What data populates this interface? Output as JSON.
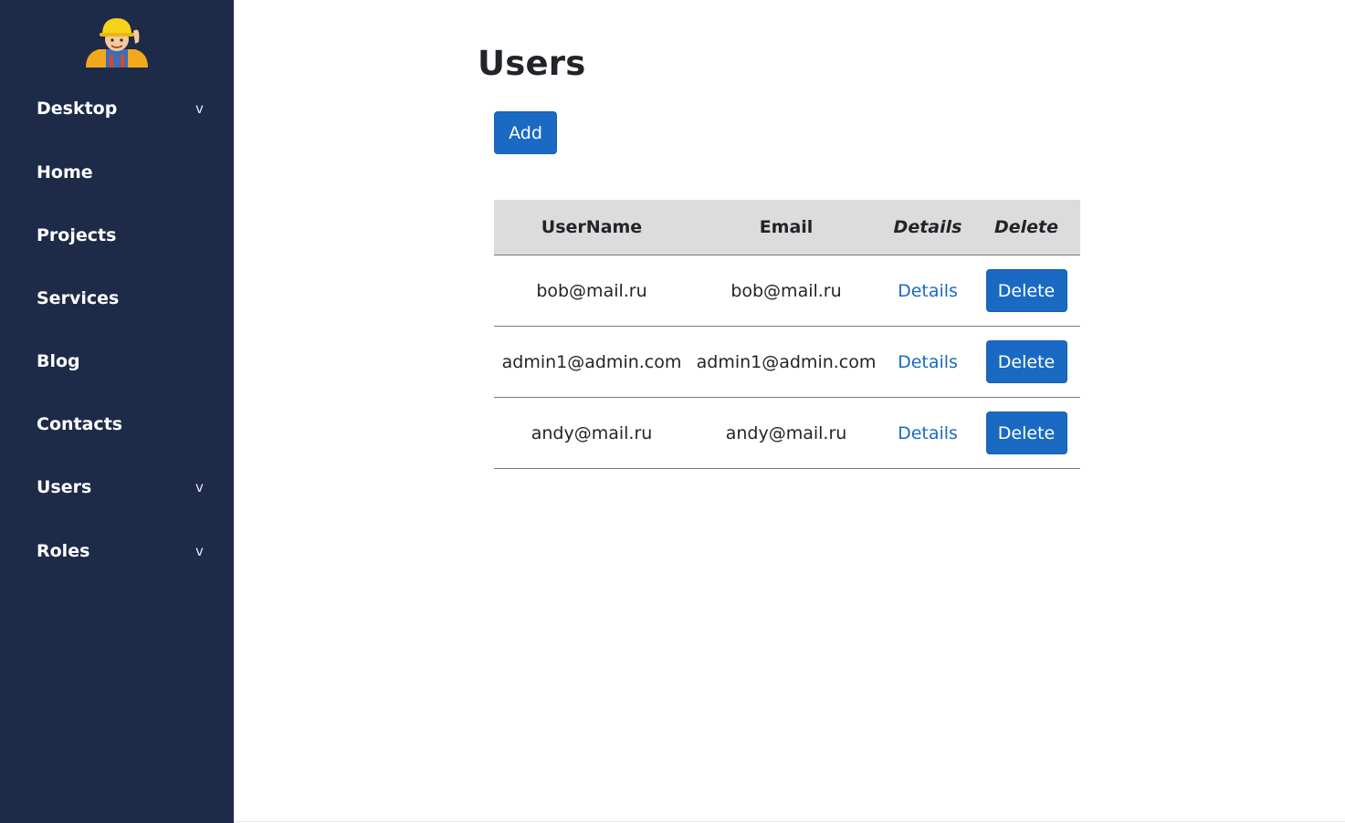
{
  "sidebar": {
    "items": [
      {
        "label": "Desktop",
        "chevron": "v"
      },
      {
        "label": "Home"
      },
      {
        "label": "Projects"
      },
      {
        "label": "Services"
      },
      {
        "label": "Blog"
      },
      {
        "label": "Contacts"
      },
      {
        "label": "Users",
        "chevron": "v"
      },
      {
        "label": "Roles",
        "chevron": "v"
      }
    ]
  },
  "main": {
    "title": "Users",
    "add_label": "Add",
    "table": {
      "headers": [
        "UserName",
        "Email",
        "Details",
        "Delete"
      ],
      "rows": [
        {
          "username": "bob@mail.ru",
          "email": "bob@mail.ru",
          "details": "Details",
          "delete": "Delete"
        },
        {
          "username": "admin1@admin.com",
          "email": "admin1@admin.com",
          "details": "Details",
          "delete": "Delete"
        },
        {
          "username": "andy@mail.ru",
          "email": "andy@mail.ru",
          "details": "Details",
          "delete": "Delete"
        }
      ]
    }
  },
  "colors": {
    "sidebar_bg": "#1d2a48",
    "accent": "#1a6ac3",
    "header_bg": "#dcdcdc"
  }
}
